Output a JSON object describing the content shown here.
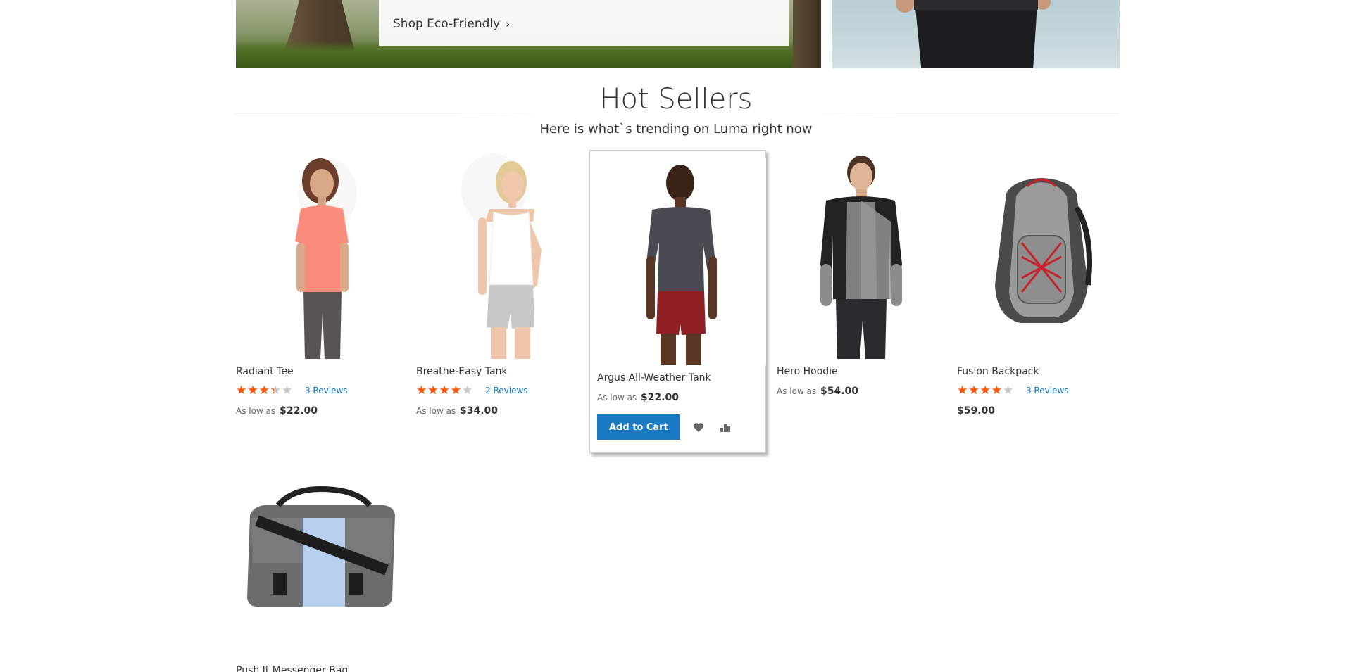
{
  "promo": {
    "link_label": "Shop Eco-Friendly",
    "chevron": "›"
  },
  "section": {
    "title": "Hot Sellers",
    "subtitle": "Here is what`s trending on Luma right now"
  },
  "products": [
    {
      "name": "Radiant Tee",
      "rating": 60,
      "reviews": "3 Reviews",
      "price_prefix": "As low as",
      "price": "$22.00"
    },
    {
      "name": "Breathe-Easy Tank",
      "rating": 70,
      "reviews": "2 Reviews",
      "price_prefix": "As low as",
      "price": "$34.00"
    },
    {
      "name": "Argus All-Weather Tank",
      "price_prefix": "As low as",
      "price": "$22.00",
      "add_to_cart": "Add to Cart"
    },
    {
      "name": "Hero Hoodie",
      "price_prefix": "As low as",
      "price": "$54.00"
    },
    {
      "name": "Fusion Backpack",
      "rating": 70,
      "reviews": "3 Reviews",
      "price": "$59.00"
    },
    {
      "name": "Push It Messenger Bag"
    }
  ],
  "icons": {
    "wishlist": "heart-icon",
    "compare": "compare-chart-icon",
    "star_glyphs": "★★★★★"
  },
  "colors": {
    "accent": "#1979c3",
    "star": "#ff5501",
    "star_empty": "#c7c7c7"
  }
}
